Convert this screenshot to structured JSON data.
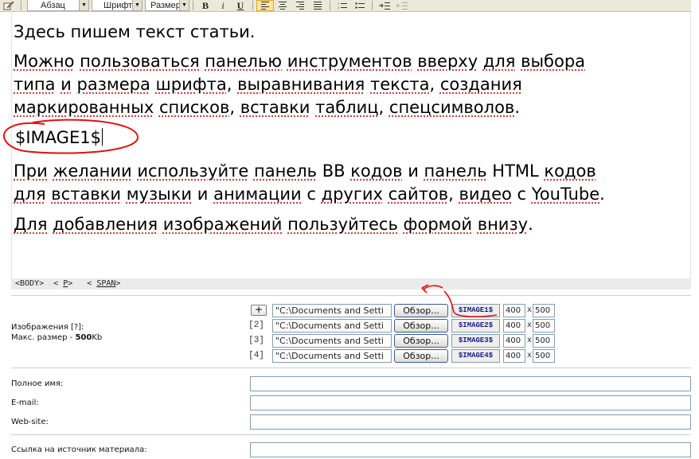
{
  "toolbar": {
    "format_select": "Абзац",
    "font_select": "Шрифт",
    "size_select": "Размер",
    "bold": "B",
    "italic": "i",
    "underline": "U"
  },
  "editor": {
    "line1": "Здесь пишем текст статьи.",
    "para2": {
      "l1": [
        "Можно",
        "пользоваться",
        "панелью",
        "инструментов",
        "вверху",
        "для",
        "выбора"
      ],
      "l2": [
        "типа",
        "и",
        "размера",
        "шрифта",
        ", ",
        "выравнивания",
        "текста",
        ", ",
        "создания"
      ],
      "l3": [
        "маркированных",
        "списков",
        ", ",
        "вставки",
        "таблиц",
        ", ",
        "спецсимволов",
        "."
      ]
    },
    "image_token": "$IMAGE1$",
    "para4": {
      "l1": [
        "При",
        "желании",
        "используйте",
        "панель",
        "BB",
        "кодов",
        "и",
        "панель",
        "HTML",
        "кодов"
      ],
      "l2": [
        "для",
        "вставки",
        "музыки",
        "и",
        "анимации",
        "с",
        "других",
        "сайтов",
        ", ",
        "видео",
        "с",
        "YouTube",
        "."
      ]
    },
    "para5": [
      "Для",
      "добавления",
      "изображений",
      "пользуйтесь",
      "формой",
      "внизу",
      "."
    ]
  },
  "pathbar": {
    "body": "<BODY>",
    "p_open": "<",
    "p": "P",
    "p_close": ">",
    "span_open": "<",
    "span": "SPAN",
    "span_close": ">"
  },
  "images": {
    "label_line1": "Изображения [?]:",
    "label_size_prefix": "Макс. размер - ",
    "label_size_value": "500",
    "label_size_unit": "Kb",
    "add_button": "+",
    "rows": [
      {
        "num": "",
        "path": "\"C:\\Documents and Setti",
        "browse": "Обзор...",
        "code": "$IMAGE1$",
        "w": "400",
        "h": "500"
      },
      {
        "num": "[2]",
        "path": "\"C:\\Documents and Setti",
        "browse": "Обзор...",
        "code": "$IMAGE2$",
        "w": "400",
        "h": "500"
      },
      {
        "num": "[3]",
        "path": "\"C:\\Documents and Setti",
        "browse": "Обзор...",
        "code": "$IMAGE3$",
        "w": "400",
        "h": "500"
      },
      {
        "num": "[4]",
        "path": "\"C:\\Documents and Setti",
        "browse": "Обзор...",
        "code": "$IMAGE4$",
        "w": "400",
        "h": "500"
      }
    ],
    "x": "x"
  },
  "form": {
    "full_name_label": "Полное имя:",
    "email_label": "E-mail:",
    "website_label": "Web-site:",
    "source_label": "Ссылка на источник материала:"
  },
  "colors": {
    "annotation": "#e01010",
    "spell_underline": "#d04040",
    "toolbar_bg": "#ece9d8"
  }
}
